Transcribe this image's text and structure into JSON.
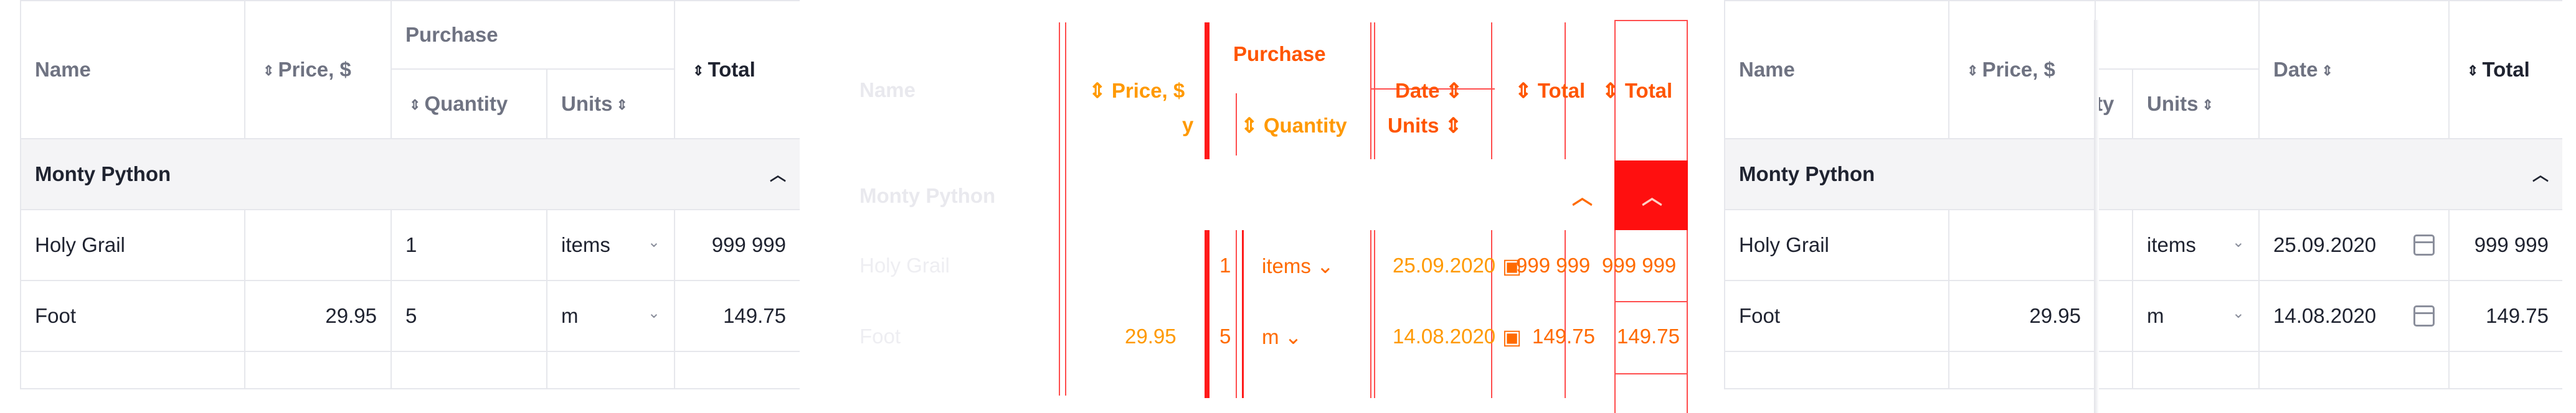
{
  "left": {
    "header": {
      "name": "Name",
      "price": "Price, $",
      "purchase": "Purchase",
      "quantity": "Quantity",
      "units": "Units",
      "total": "Total"
    },
    "group": "Monty Python",
    "rows": [
      {
        "name": "Holy Grail",
        "price": "",
        "quantity": "1",
        "units": "items",
        "total": "999 999"
      },
      {
        "name": "Foot",
        "price": "29.95",
        "quantity": "5",
        "units": "m",
        "total": "149.75"
      }
    ]
  },
  "middle": {
    "header": {
      "name": "Name",
      "price": "Price, $",
      "purchase": "Purchase",
      "quantity": "Quantity",
      "units": "Units",
      "date": "Date",
      "total": "Total",
      "total2": "Total"
    },
    "group": "Monty Python",
    "rows": [
      {
        "name": "Holy Grail",
        "quantity": "1",
        "units": "items",
        "date": "25.09.2020",
        "total": "999 999",
        "total2": "999 999"
      },
      {
        "name": "Foot",
        "price": "29.95",
        "quantity": "5",
        "units": "m",
        "date": "14.08.2020",
        "total": "149.75",
        "total2": "149.75"
      }
    ]
  },
  "right": {
    "header": {
      "name": "Name",
      "price": "Price, $",
      "quantity_partial": "ty",
      "units": "Units",
      "date": "Date",
      "total": "Total"
    },
    "group": "Monty Python",
    "rows": [
      {
        "name": "Holy Grail",
        "units": "items",
        "date": "25.09.2020",
        "total": "999 999"
      },
      {
        "name": "Foot",
        "price": "29.95",
        "units": "m",
        "date": "14.08.2020",
        "total": "149.75"
      }
    ]
  },
  "icons": {
    "sort": "sort-updown-icon",
    "collapse": "chevron-up-icon",
    "dropdown": "chevron-down-icon",
    "calendar": "calendar-icon"
  }
}
